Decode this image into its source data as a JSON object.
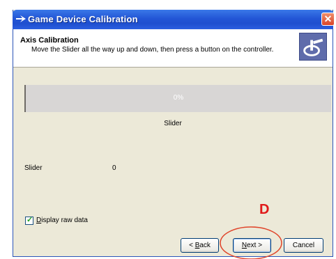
{
  "window": {
    "title": "Game Device Calibration",
    "close_glyph": "✕"
  },
  "header": {
    "title": "Axis Calibration",
    "subtitle": "Move the Slider all the way up and down, then press a button on the controller.",
    "icon": "joystick-icon"
  },
  "progress": {
    "text": "0%",
    "value": 0,
    "fill_color": "#2f5fd0"
  },
  "axis_label": "Slider",
  "raw_data": {
    "label": "Slider",
    "value": "0"
  },
  "options": {
    "display_raw_data_label_prefix": "D",
    "display_raw_data_label_rest": "isplay raw data",
    "display_raw_data_checked": true
  },
  "buttons": {
    "back_label": "Back",
    "back_underline": "B",
    "back_prefix": "< ",
    "back_rest": "ack",
    "next_label": "Next",
    "next_underline": "N",
    "next_rest": "ext",
    "next_suffix": " >",
    "cancel_label": "Cancel"
  },
  "annotation": {
    "letter": "D",
    "color": "#e01a1a"
  }
}
